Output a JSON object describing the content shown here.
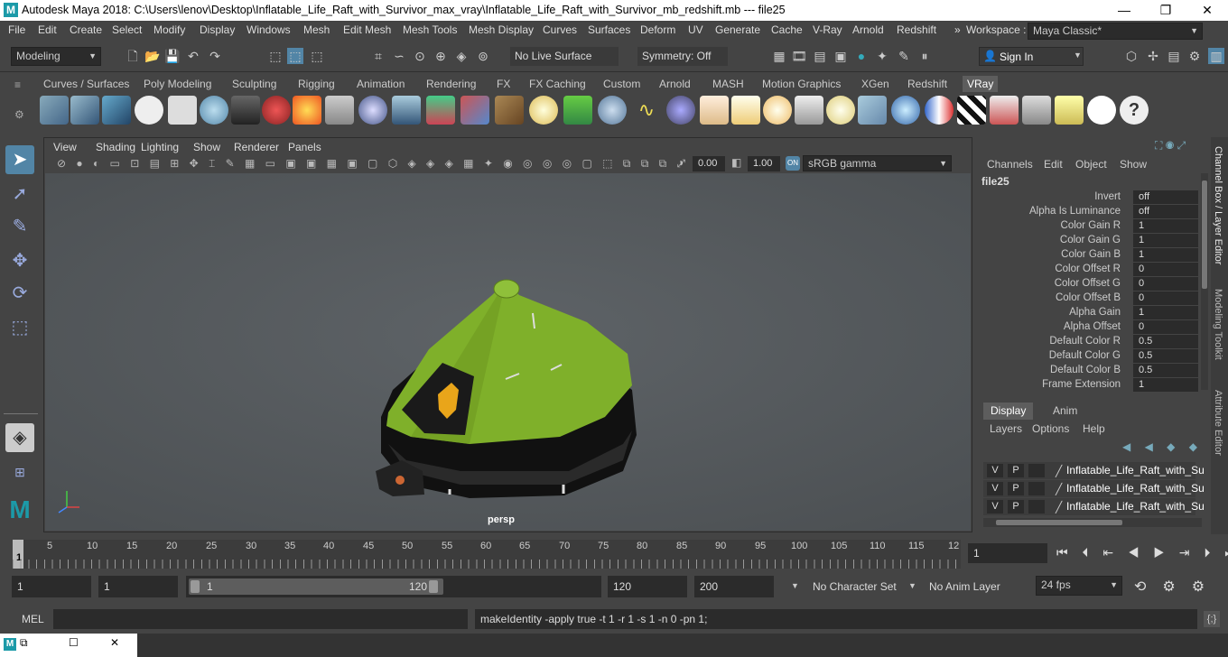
{
  "window": {
    "title": "Autodesk Maya 2018: C:\\Users\\lenov\\Desktop\\Inflatable_Life_Raft_with_Survivor_max_vray\\Inflatable_Life_Raft_with_Survivor_mb_redshift.mb  ---  file25",
    "minimize": "—",
    "maximize": "❐",
    "close": "✕"
  },
  "menubar": [
    "File",
    "Edit",
    "Create",
    "Select",
    "Modify",
    "Display",
    "Windows",
    "Mesh",
    "Edit Mesh",
    "Mesh Tools",
    "Mesh Display",
    "Curves",
    "Surfaces",
    "Deform",
    "UV",
    "Generate",
    "Cache",
    "V-Ray",
    "Arnold",
    "Redshift"
  ],
  "workspace": {
    "label": "Workspace :",
    "value": "Maya Classic*"
  },
  "status": {
    "mode": "Modeling",
    "live_surface": "No Live Surface",
    "symmetry": "Symmetry: Off",
    "sign_in": "Sign In"
  },
  "shelf_tabs": [
    "Curves / Surfaces",
    "Poly Modeling",
    "Sculpting",
    "Rigging",
    "Animation",
    "Rendering",
    "FX",
    "FX Caching",
    "Custom",
    "Arnold",
    "MASH",
    "Motion Graphics",
    "XGen",
    "Redshift",
    "VRay"
  ],
  "shelf_active": "VRay",
  "panel": {
    "menus": [
      "View",
      "Shading",
      "Lighting",
      "Show",
      "Renderer",
      "Panels"
    ],
    "exposure": "0.00",
    "gamma": "1.00",
    "color_space": "sRGB gamma",
    "camera_label": "persp"
  },
  "channel_box": {
    "menus": [
      "Channels",
      "Edit",
      "Object",
      "Show"
    ],
    "node": "file25",
    "attrs": [
      {
        "name": "Invert",
        "value": "off"
      },
      {
        "name": "Alpha Is Luminance",
        "value": "off"
      },
      {
        "name": "Color Gain R",
        "value": "1"
      },
      {
        "name": "Color Gain G",
        "value": "1"
      },
      {
        "name": "Color Gain B",
        "value": "1"
      },
      {
        "name": "Color Offset R",
        "value": "0"
      },
      {
        "name": "Color Offset G",
        "value": "0"
      },
      {
        "name": "Color Offset B",
        "value": "0"
      },
      {
        "name": "Alpha Gain",
        "value": "1"
      },
      {
        "name": "Alpha Offset",
        "value": "0"
      },
      {
        "name": "Default Color R",
        "value": "0.5"
      },
      {
        "name": "Default Color G",
        "value": "0.5"
      },
      {
        "name": "Default Color B",
        "value": "0.5"
      },
      {
        "name": "Frame Extension",
        "value": "1"
      }
    ]
  },
  "layer_editor": {
    "tabs": [
      "Display",
      "Anim"
    ],
    "menus": [
      "Layers",
      "Options",
      "Help"
    ],
    "rows": [
      {
        "v": "V",
        "p": "P",
        "name": "Inflatable_Life_Raft_with_Su"
      },
      {
        "v": "V",
        "p": "P",
        "name": "Inflatable_Life_Raft_with_Su"
      },
      {
        "v": "V",
        "p": "P",
        "name": "Inflatable_Life_Raft_with_Su"
      }
    ]
  },
  "side_tabs": [
    "Channel Box / Layer Editor",
    "Modeling Toolkit",
    "Attribute Editor"
  ],
  "timeline": {
    "ticks": [
      "1",
      "5",
      "10",
      "15",
      "20",
      "25",
      "30",
      "35",
      "40",
      "45",
      "50",
      "55",
      "60",
      "65",
      "70",
      "75",
      "80",
      "85",
      "90",
      "95",
      "100",
      "105",
      "110",
      "115",
      "12"
    ],
    "current_frame": "1"
  },
  "range": {
    "start": "1",
    "playback_start": "1",
    "slider_start": "1",
    "slider_end": "120",
    "playback_end": "120",
    "end": "200",
    "character_set": "No Character Set",
    "anim_layer": "No Anim Layer",
    "fps": "24 fps"
  },
  "command": {
    "lang": "MEL",
    "output": "makeIdentity -apply true -t 1 -r 1 -s 1 -n 0 -pn 1;"
  }
}
